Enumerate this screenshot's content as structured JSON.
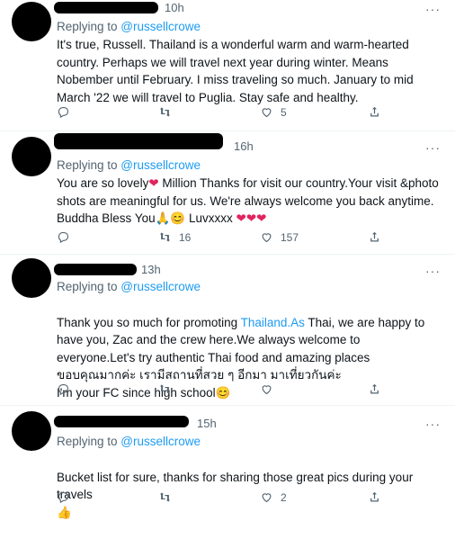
{
  "tweets": [
    {
      "time": "10h",
      "reply_prefix": "Replying to ",
      "reply_handle": "@russellcrowe",
      "text": "It's true, Russell. Thailand is a wonderful warm and warm-hearted country. Perhaps we will travel next year during winter. Means Nobember until February. I miss traveling so much. January to mid March '22 we will travel to Puglia. Stay safe and healthy.",
      "replies": "",
      "retweets": "",
      "likes": "5"
    },
    {
      "time": "16h",
      "reply_prefix": "Replying to ",
      "reply_handle": "@russellcrowe",
      "text_a": "You are so lovely",
      "text_b": " Million Thanks for visit our country.Your visit &photo shots are meaningful for us. We're always welcome you back anytime. Buddha Bless You",
      "text_c": " Luvxxxx ",
      "replies": "",
      "retweets": "16",
      "likes": "157"
    },
    {
      "time": "13h",
      "reply_prefix": "Replying to ",
      "reply_handle": "@russellcrowe",
      "text_a": "Thank you so much for promoting ",
      "text_link": "Thailand.As",
      "text_b": " Thai, we are happy to have you, Zac and the crew here.We always welcome to everyone.Let's try authentic Thai food and amazing places\nขอบคุณมากค่ะ เรามีสถานที่สวย ๆ อีกมา มาเที่ยวกันค่ะ\nI'm your FC since high school",
      "replies": "",
      "retweets": "",
      "likes": ""
    },
    {
      "time": "15h",
      "reply_prefix": "Replying to ",
      "reply_handle": "@russellcrowe",
      "text": "Bucket list for sure, thanks for sharing those great pics during your travels",
      "replies": "",
      "retweets": "",
      "likes": "2"
    }
  ],
  "icons": {
    "reply": "reply-icon",
    "retweet": "retweet-icon",
    "like": "heart-icon",
    "share": "share-icon",
    "more": "more-icon"
  },
  "colors": {
    "link": "#1d9bf0",
    "muted": "#536471",
    "heart_emoji": "#e0245e"
  }
}
